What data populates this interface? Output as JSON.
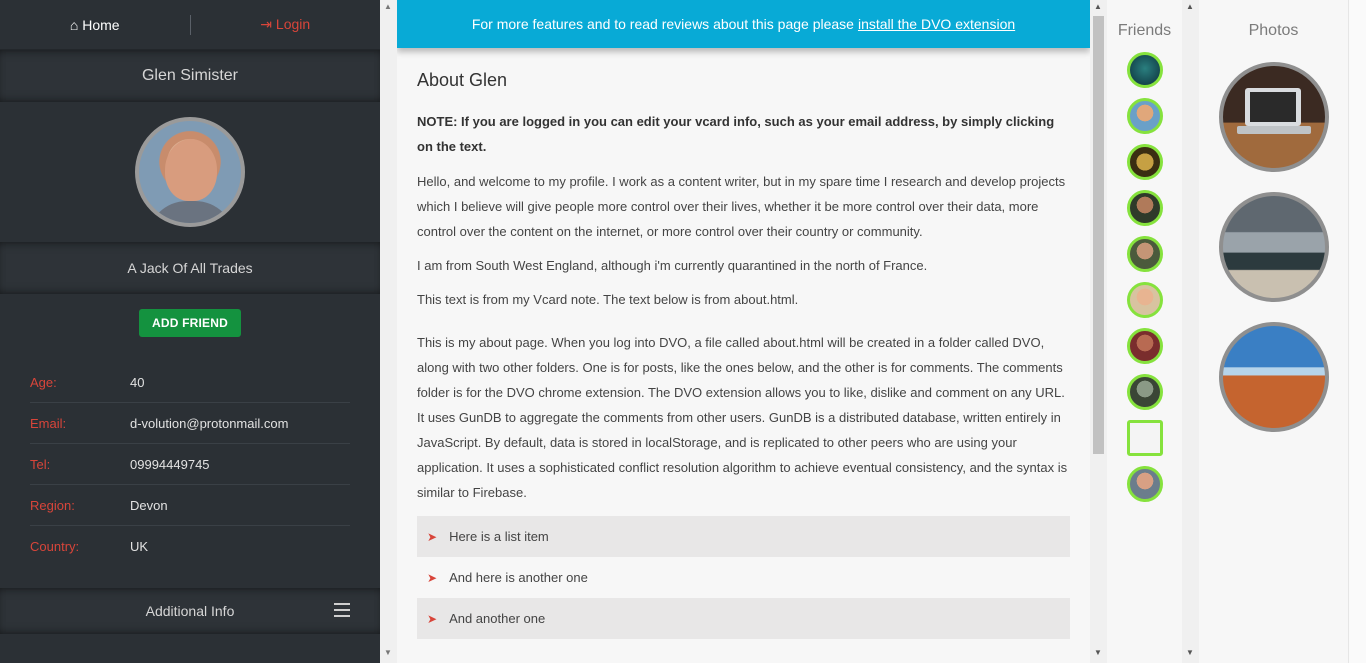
{
  "nav": {
    "home": "Home",
    "login": "Login"
  },
  "profile": {
    "name": "Glen Simister",
    "tagline": "A Jack Of All Trades",
    "add_friend": "ADD FRIEND",
    "fields": [
      {
        "label": "Age:",
        "value": "40"
      },
      {
        "label": "Email:",
        "value": "d-volution@protonmail.com"
      },
      {
        "label": "Tel:",
        "value": "09994449745"
      },
      {
        "label": "Region:",
        "value": "Devon"
      },
      {
        "label": "Country:",
        "value": "UK"
      }
    ],
    "additional": "Additional Info"
  },
  "banner": {
    "text": "For more features and to read reviews about this page please",
    "link": "install the DVO extension",
    "color": "#08aad6"
  },
  "about": {
    "title": "About Glen",
    "note": "NOTE: If you are logged in you can edit your vcard info, such as your email address, by simply clicking on the text.",
    "p1": "Hello, and welcome to my profile. I work as a content writer, but in my spare time I research and develop projects which I believe will give people more control over their lives, whether it be more control over their data,  more control over the content on the internet, or more control over their country or community.",
    "p2": "I am from South West England, although i'm currently quarantined in the north of France.",
    "p3": "This text is from my Vcard note. The text below is from about.html.",
    "p4": "This is my about page. When you log into DVO, a file called about.html will be created in a folder called DVO, along with two other folders.  One is for posts, like the ones below, and the other is for comments. The comments folder is for the DVO chrome extension. The DVO extension allows you to like, dislike and comment on any URL. It uses GunDB to aggregate the comments from other users. GunDB is a distributed database, written entirely in JavaScript. By default, data is stored in localStorage, and is replicated to other peers who are using your application. It uses a sophisticated conflict resolution algorithm to achieve eventual consistency, and the syntax is similar to Firebase.",
    "list": [
      "Here is a list item",
      "And here is another one",
      "And another one"
    ]
  },
  "friends": {
    "title": "Friends",
    "count": 10
  },
  "photos": {
    "title": "Photos"
  },
  "colors": {
    "accent_red": "#d8453a",
    "add_green": "#14923f",
    "friend_ring": "#86e23d",
    "sidebar_bg": "#2b3035"
  }
}
